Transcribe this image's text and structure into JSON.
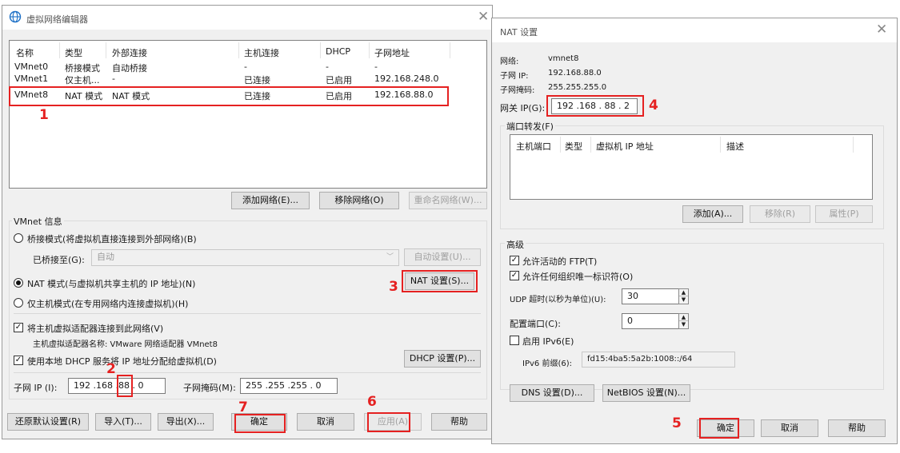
{
  "left_dialog": {
    "title": "虚拟网络编辑器",
    "list": {
      "headers": [
        "名称",
        "类型",
        "外部连接",
        "主机连接",
        "DHCP",
        "子网地址"
      ],
      "rows": [
        [
          "VMnet0",
          "桥接模式",
          "自动桥接",
          "-",
          "-",
          "-"
        ],
        [
          "VMnet1",
          "仅主机...",
          "-",
          "已连接",
          "已启用",
          "192.168.248.0"
        ],
        [
          "VMnet8",
          "NAT 模式",
          "NAT 模式",
          "已连接",
          "已启用",
          "192.168.88.0"
        ]
      ]
    },
    "buttons": {
      "add_network": "添加网络(E)...",
      "remove_network": "移除网络(O)",
      "rename_network": "重命名网络(W)..."
    },
    "vmnet_info": {
      "group_title": "VMnet 信息",
      "bridged_label": "桥接模式(将虚拟机直接连接到外部网络)(B)",
      "bridged_to_label": "已桥接至(G):",
      "bridged_to_value": "自动",
      "auto_settings": "自动设置(U)...",
      "nat_label": "NAT 模式(与虚拟机共享主机的 IP 地址)(N)",
      "nat_settings": "NAT 设置(S)...",
      "hostonly_label": "仅主机模式(在专用网络内连接虚拟机)(H)",
      "connect_adapter_label": "将主机虚拟适配器连接到此网络(V)",
      "adapter_name_text": "主机虚拟适配器名称: VMware 网络适配器 VMnet8",
      "dhcp_label": "使用本地 DHCP 服务将 IP 地址分配给虚拟机(D)",
      "dhcp_settings": "DHCP 设置(P)...",
      "subnet_ip_label": "子网 IP (I):",
      "subnet_ip_value": "192 .168 .88  .  0",
      "subnet_mask_label": "子网掩码(M):",
      "subnet_mask_value": "255 .255 .255 .  0"
    },
    "bottom_buttons": {
      "restore": "还原默认设置(R)",
      "import": "导入(T)...",
      "export": "导出(X)...",
      "ok": "确定",
      "cancel": "取消",
      "apply": "应用(A)",
      "help": "帮助"
    }
  },
  "right_dialog": {
    "title": "NAT 设置",
    "network_label": "网络:",
    "network_value": "vmnet8",
    "subnet_ip_label": "子网 IP:",
    "subnet_ip_value": "192.168.88.0",
    "subnet_mask_label": "子网掩码:",
    "subnet_mask_value": "255.255.255.0",
    "gateway_label": "网关 IP(G):",
    "gateway_value": "192 .168 . 88  .  2",
    "port_forwarding": {
      "group_title": "端口转发(F)",
      "headers": [
        "主机端口",
        "类型",
        "虚拟机 IP 地址",
        "描述"
      ],
      "add": "添加(A)...",
      "remove": "移除(R)",
      "properties": "属性(P)"
    },
    "advanced": {
      "group_title": "高级",
      "allow_ftp": "允许活动的 FTP(T)",
      "allow_any_oui": "允许任何组织唯一标识符(O)",
      "udp_timeout_label": "UDP 超时(以秒为单位)(U):",
      "udp_timeout_value": "30",
      "config_port_label": "配置端口(C):",
      "config_port_value": "0",
      "enable_ipv6": "启用 IPv6(E)",
      "ipv6_prefix_label": "IPv6 前缀(6):",
      "ipv6_prefix_value": "fd15:4ba5:5a2b:1008::/64",
      "dns_settings": "DNS 设置(D)...",
      "netbios_settings": "NetBIOS 设置(N)..."
    },
    "bottom_buttons": {
      "ok": "确定",
      "cancel": "取消",
      "help": "帮助"
    }
  },
  "step_markers": [
    "1",
    "2",
    "3",
    "4",
    "5",
    "6",
    "7"
  ],
  "colors": {
    "annotation_red": "#e52121",
    "dialog_bg": "#f0f0f0",
    "title_icon_blue": "#1d70c6"
  }
}
